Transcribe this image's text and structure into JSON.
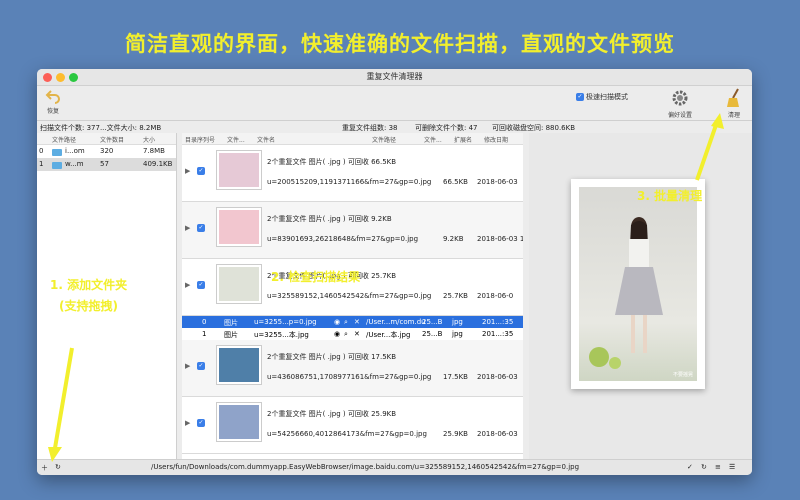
{
  "headline": "简洁直观的界面，快速准确的文件扫描，直观的文件预览",
  "window": {
    "title": "重复文件清理器"
  },
  "toolbar": {
    "undo_label": "恢复",
    "fast_scan_label": "极速扫描模式",
    "prefs_label": "偏好设置",
    "clean_label": "清理"
  },
  "stats": {
    "left": "扫描文件个数: 377...文件大小: 8.2MB",
    "groups": "重复文件组数: 38",
    "deletable": "可删除文件个数: 47",
    "reclaim": "可回收磁盘空间: 880.6KB"
  },
  "left_pane": {
    "columns": [
      "文件路径",
      "文件数目",
      "大小"
    ],
    "rows": [
      {
        "index": "0",
        "path": "i...om",
        "count": "320",
        "size": "7.8MB"
      },
      {
        "index": "1",
        "path": "w...m",
        "count": "57",
        "size": "409.1KB"
      }
    ]
  },
  "mid_pane": {
    "columns": [
      "目录序列号",
      "文件...",
      "文件名",
      "文件路径",
      "文件...",
      "扩展名",
      "修改日期"
    ],
    "groups": [
      {
        "summary": "2个重复文件   图片( .jpg )   可回收 66.5KB",
        "name": "u=200515209,1191371166&fm=27&gp=0.jpg",
        "size": "66.5KB",
        "date": "2018-06-03",
        "thumb": "#e6c9d6"
      },
      {
        "summary": "2个重复文件   图片( .jpg )   可回收 9.2KB",
        "name": "u=83901693,26218648&fm=27&gp=0.jpg",
        "size": "9.2KB",
        "date": "2018-06-03 1",
        "thumb": "#f2c6cf"
      },
      {
        "summary": "2个重复文件   图片( .jpg )   可回收 25.7KB",
        "name": "u=325589152,1460542542&fm=27&gp=0.jpg",
        "size": "25.7KB",
        "date": "2018-06-0",
        "thumb": "#dfe2d8"
      },
      {
        "summary": "2个重复文件   图片( .jpg )   可回收 17.5KB",
        "name": "u=436086751,1708977161&fm=27&gp=0.jpg",
        "size": "17.5KB",
        "date": "2018-06-03",
        "thumb": "#4f7fa8"
      },
      {
        "summary": "2个重复文件   图片( .jpg )   可回收 25.9KB",
        "name": "u=54256660,4012864173&fm=27&gp=0.jpg",
        "size": "25.9KB",
        "date": "2018-06-03",
        "thumb": "#8fa3c9"
      }
    ],
    "subrows": [
      {
        "idx": "0",
        "type": "图片",
        "name": "u=3255...p=0.jpg",
        "path": "/User...m/com.du",
        "size": "25...B",
        "ext": "jpg",
        "date": "201...:35"
      },
      {
        "idx": "1",
        "type": "图片",
        "name": "u=3255...本.jpg",
        "path": "/User...本.jpg",
        "size": "25...B",
        "ext": "jpg",
        "date": "201...:35"
      }
    ]
  },
  "status": {
    "path": "/Users/fun/Downloads/com.dummyapp.EasyWebBrowser/image.baidu.com/u=325589152,1460542542&fm=27&gp=0.jpg"
  },
  "photo_watermark": "不要摇晃",
  "annotations": {
    "add_folder": "1. 添加文件夹",
    "add_folder_sub": "(支持拖拽)",
    "check_results": "2. 检查扫描结果",
    "batch_clean": "3. 批量清理"
  },
  "colors": {
    "accent": "#2a6fde",
    "annotation": "#f2ef2d",
    "background": "#5a82b7"
  }
}
